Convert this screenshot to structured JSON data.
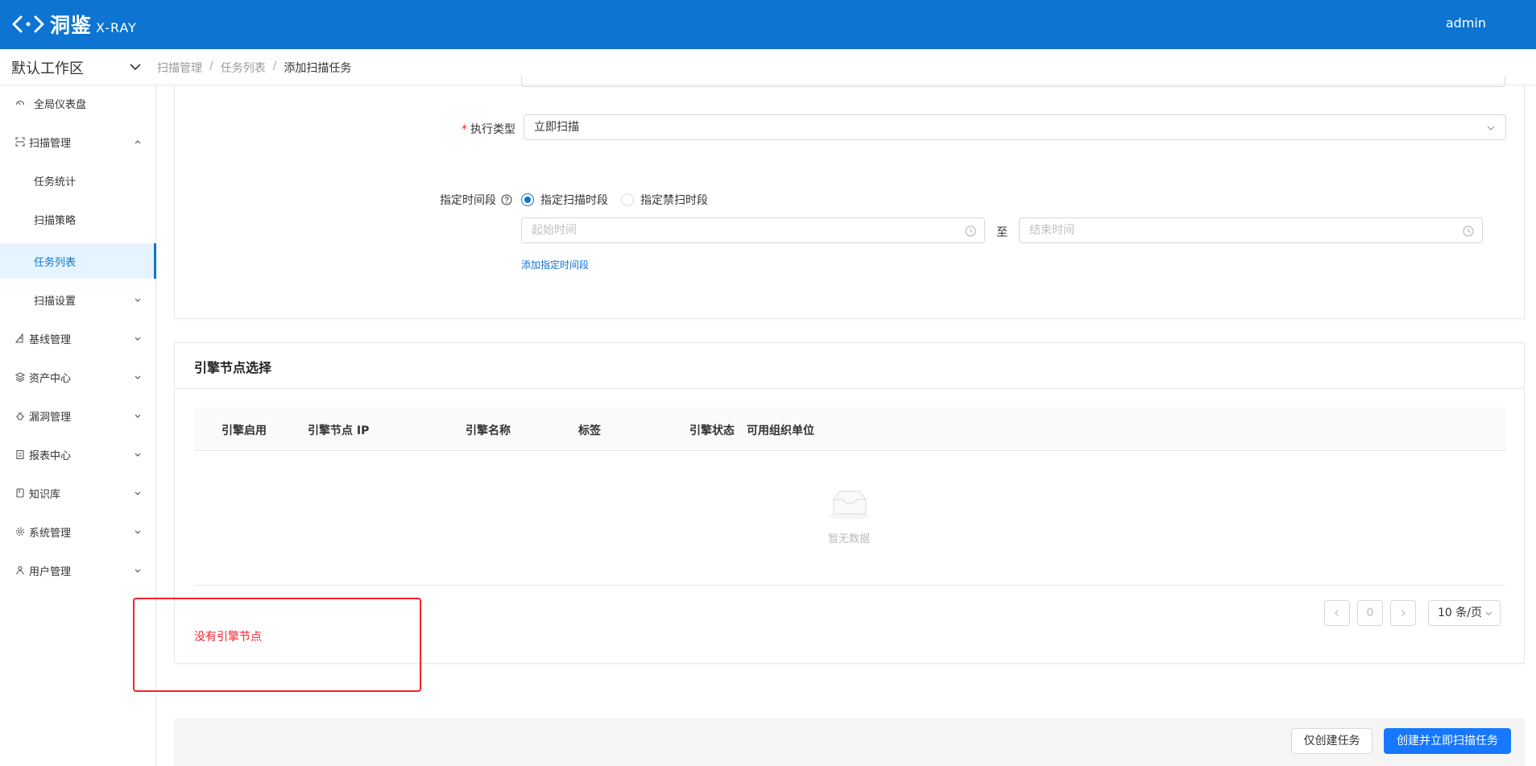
{
  "header": {
    "logo_cn": "洞鉴",
    "logo_en": "X-RAY",
    "user": "admin"
  },
  "workspace": {
    "label": "默认工作区"
  },
  "breadcrumb": [
    "扫描管理",
    "任务列表",
    "添加扫描任务"
  ],
  "sidebar": {
    "items": [
      {
        "label": "全局仪表盘",
        "icon": "dashboard-icon"
      },
      {
        "label": "扫描管理",
        "icon": "scan-icon",
        "expanded": true
      },
      {
        "label": "任务统计"
      },
      {
        "label": "扫描策略"
      },
      {
        "label": "任务列表",
        "active": true
      },
      {
        "label": "扫描设置"
      },
      {
        "label": "基线管理",
        "icon": "baseline-icon"
      },
      {
        "label": "资产中心",
        "icon": "asset-icon"
      },
      {
        "label": "漏洞管理",
        "icon": "bug-icon"
      },
      {
        "label": "报表中心",
        "icon": "report-icon"
      },
      {
        "label": "知识库",
        "icon": "book-icon"
      },
      {
        "label": "系统管理",
        "icon": "gear-icon"
      },
      {
        "label": "用户管理",
        "icon": "user-icon"
      }
    ]
  },
  "form": {
    "exec_type_label": "执行类型",
    "exec_type_value": "立即扫描",
    "period_label": "指定时间段",
    "radio_scan": "指定扫描时段",
    "radio_noscan": "指定禁扫时段",
    "start_placeholder": "起始时间",
    "to": "至",
    "end_placeholder": "结束时间",
    "add_period": "添加指定时间段"
  },
  "engine": {
    "title": "引擎节点选择",
    "columns": [
      "引擎启用",
      "引擎节点 IP",
      "引擎名称",
      "标签",
      "引擎状态",
      "可用组织单位"
    ],
    "empty_text": "暂无数据",
    "page": "0",
    "page_size": "10 条/页",
    "error": "没有引擎节点"
  },
  "footer": {
    "create_only": "仅创建任务",
    "create_and_scan": "创建并立即扫描任务"
  }
}
